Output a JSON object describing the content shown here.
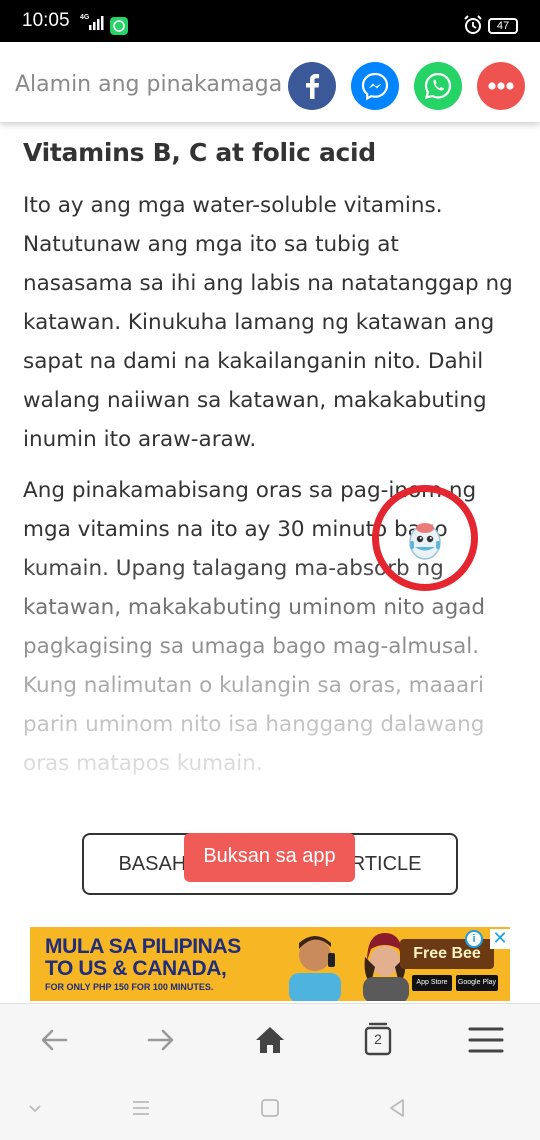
{
  "status_bar": {
    "time": "10:05",
    "network": "4G",
    "battery": "47"
  },
  "share_bar": {
    "title": "Alamin ang pinakamaga",
    "buttons": [
      {
        "name": "facebook",
        "icon": "facebook-icon",
        "color": "#3b5998"
      },
      {
        "name": "messenger",
        "icon": "messenger-icon",
        "color": "#0084ff"
      },
      {
        "name": "whatsapp",
        "icon": "whatsapp-icon",
        "color": "#25d366"
      },
      {
        "name": "more",
        "icon": "more-dots-icon",
        "color": "#ef5350"
      }
    ]
  },
  "article": {
    "heading": "Vitamins B, C at folic acid",
    "paragraph1": "Ito ay ang mga water-soluble vitamins. Natutunaw ang mga ito sa tubig at nasasama sa ihi ang labis na natatanggap ng katawan. Kinukuha lamang ng katawan ang sapat na dami na kakailanganin nito. Dahil walang naiiwan sa katawan, makakabuting inumin ito araw-araw.",
    "paragraph2": "Ang pinakamabisang oras sa pag-inom ng mga vitamins na ito ay 30 minuto bago kumain. Upang talagang ma-absorb ng katawan, makakabuting uminom nito agad pagkagising sa umaga bago mag-almusal. Kung nalimutan o kulangin sa oras, maaari parin uminom nito isa hanggang dalawang oras matapos kumain."
  },
  "read_full_button": "BASAHIN ANG BUONG ARTICLE",
  "app_pill": "Buksan sa app",
  "ad": {
    "line1": "MULA SA PILIPINAS",
    "line2": "TO US & CANADA,",
    "line3": "FOR ONLY PHP 150 FOR 100 MINUTES.",
    "brand": "Free Bee",
    "store1": "App Store",
    "store2": "Google Play",
    "info": "i",
    "close": "✕"
  },
  "browser_toolbar": {
    "tab_count": "2"
  },
  "colors": {
    "accent_red": "#e3262f",
    "pill": "#f05a57",
    "ad_bg": "#f7b725"
  }
}
